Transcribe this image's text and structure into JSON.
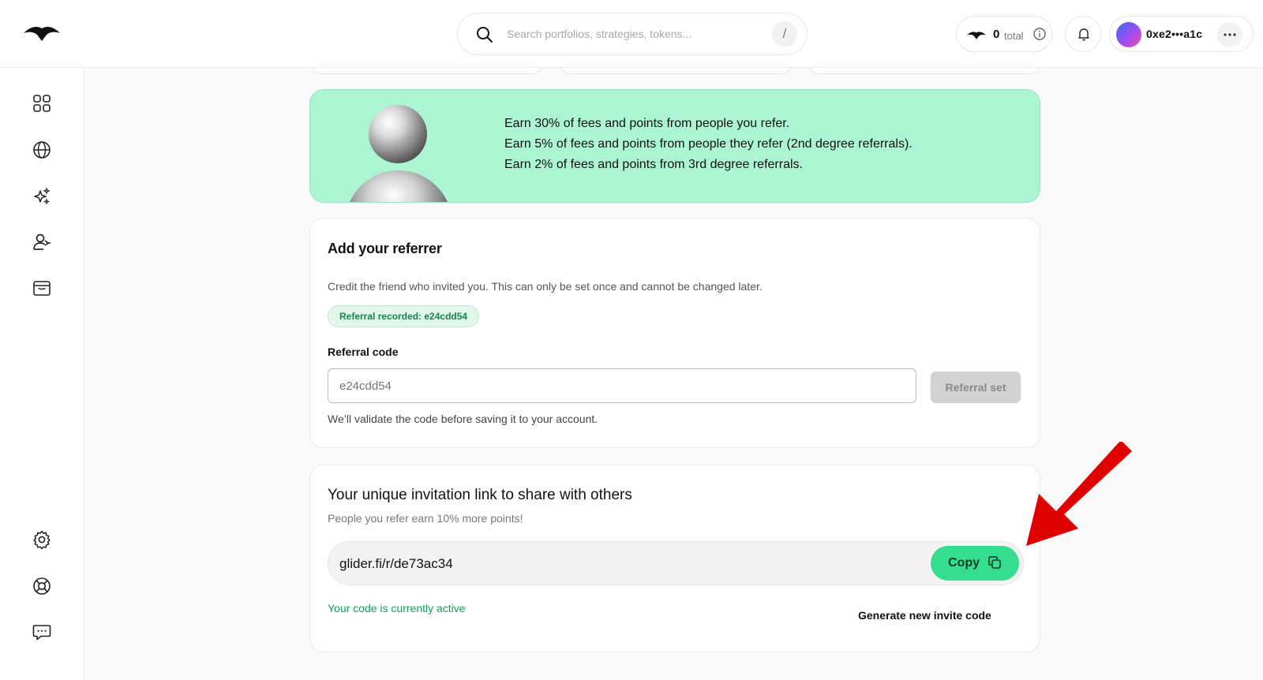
{
  "header": {
    "search_placeholder": "Search portfolios, strategies, tokens...",
    "search_shortcut": "/",
    "points_value": "0",
    "points_label": "total",
    "account_address": "0xe2•••a1c"
  },
  "sidebar": {
    "items": [
      {
        "icon": "dashboard-icon"
      },
      {
        "icon": "globe-icon"
      },
      {
        "icon": "sparkles-icon"
      },
      {
        "icon": "referral-icon"
      },
      {
        "icon": "wallet-icon"
      }
    ],
    "bottom_items": [
      {
        "icon": "settings-gear-icon"
      },
      {
        "icon": "help-lifebuoy-icon"
      },
      {
        "icon": "chat-icon"
      }
    ]
  },
  "banner": {
    "lines": [
      "Earn 30% of fees and points from people you refer.",
      "Earn 5% of fees and points from people they refer (2nd degree referrals).",
      "Earn 2% of fees and points from 3rd degree referrals."
    ]
  },
  "referrer_card": {
    "title": "Add your referrer",
    "description": "Credit the friend who invited you. This can only be set once and cannot be changed later.",
    "badge": "Referral recorded: e24cdd54",
    "field_label": "Referral code",
    "field_placeholder": "e24cdd54",
    "button_label": "Referral set",
    "help_text": "We’ll validate the code before saving it to your account."
  },
  "invite_card": {
    "title": "Your unique invitation link to share with others",
    "subtitle": "People you refer earn 10% more points!",
    "link": "glider.fi/r/de73ac34",
    "copy_label": "Copy",
    "status": "Your code is currently active",
    "generate_label": "Generate new invite code"
  },
  "colors": {
    "banner_bg": "#abf5d3",
    "copy_button": "#36dd8e",
    "active_text": "#12a05a",
    "annotation_arrow": "#e00000"
  }
}
